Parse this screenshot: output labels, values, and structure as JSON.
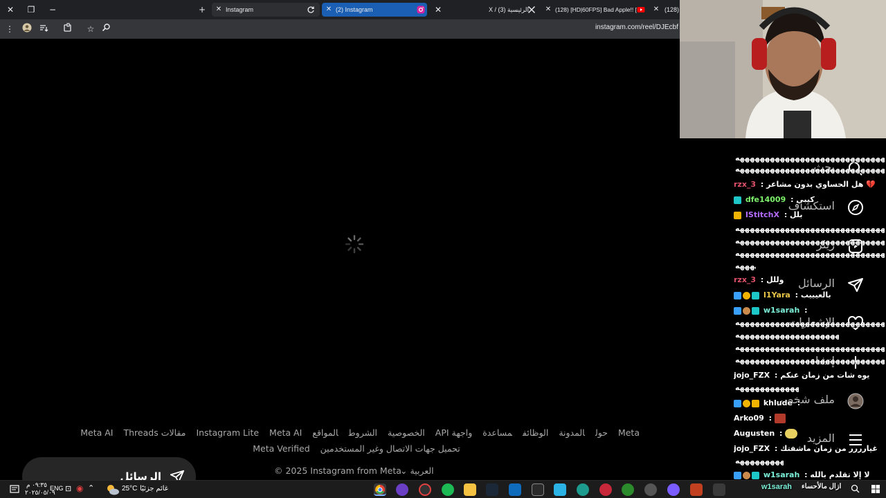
{
  "browser": {
    "window_controls": {
      "close": "✕",
      "restore": "❐",
      "minimize": "−",
      "new_tab": "+"
    },
    "tabs": [
      {
        "title": "Instagram",
        "close": "✕"
      },
      {
        "title": "(2) Instagram",
        "close": "✕",
        "active": true
      },
      {
        "title": "X / (3) الرئيسية",
        "close": "✕"
      },
      {
        "title": "(128) [HD|60FPS] Bad Apple!! [",
        "close": "✕"
      },
      {
        "title": "(128)",
        "close": "✕"
      }
    ],
    "url": "instagram.com/reel/DJEcbf"
  },
  "page": {
    "footer_row1": [
      "Meta",
      "حول",
      "المدونة",
      "الوظائف",
      "مساعدة",
      "واجهة API",
      "الخصوصية",
      "الشروط",
      "المواقع",
      "Instagram Lite",
      "Meta AI",
      "مقالات Meta AI",
      "Threads"
    ],
    "footer_row2": [
      "تحميل جهات الاتصال وغير المستخدمين",
      "Meta Verified"
    ],
    "language": "العربية",
    "copyright": "© 2025 Instagram from Meta",
    "messages_button": "الرسائل"
  },
  "sidebar_nav": [
    {
      "label": "بحث",
      "icon": "search-icon"
    },
    {
      "label": "استكشاف",
      "icon": "explore-icon"
    },
    {
      "label": "ريلز",
      "icon": "reels-icon"
    },
    {
      "label": "الرسائل",
      "icon": "messages-icon"
    },
    {
      "label": "الإشعارات",
      "icon": "heart-icon"
    },
    {
      "label": "إنشاء",
      "icon": "plus-icon"
    },
    {
      "label": "ملف شخصي",
      "icon": "avatar-icon"
    },
    {
      "label": "المزيد",
      "icon": "menu-icon"
    }
  ],
  "chat": {
    "spam_block": "ههههههههههههههههههههههههههههههههههههههههه",
    "messages": [
      {
        "user": "rzx_3",
        "text": "هل الحساوي بدون مشاعر",
        "color": "#e0516a",
        "emoji": "💔"
      },
      {
        "user": "dfe14009",
        "text": "كيبي",
        "color": "#7cf06a"
      },
      {
        "user": "IStitchX",
        "text": "بلل",
        "color": "#b46cff"
      },
      {
        "user": "rzx_3",
        "text": "وللل",
        "color": "#e0516a"
      },
      {
        "user": "I1Yara",
        "text": "بالعيييب",
        "color": "#e8c547"
      },
      {
        "user": "w1sarah",
        "text": "",
        "color": "#7cf0d8"
      },
      {
        "user": "jojo_FZX",
        "text": "يوه شات من زمان عنكم",
        "color": "#ffffff"
      },
      {
        "user": "khlude",
        "text": "",
        "color": "#ffffff"
      },
      {
        "user": "Arko09",
        "text": "",
        "color": "#ffffff"
      },
      {
        "user": "Augusten",
        "text": "",
        "color": "#ffffff"
      },
      {
        "user": "jojo_FZX",
        "text": "غيارررر من زمان ماشفتك",
        "color": "#ffffff"
      },
      {
        "user": "w1sarah",
        "text": "لا إلا تقلدم بالله",
        "color": "#7cf0d8"
      },
      {
        "user": "w1sarah",
        "text": "ازال مالأحساء",
        "color": "#7cf0d8"
      }
    ]
  },
  "taskbar": {
    "time": "٠٩:٣٥ م",
    "date": "٢٠٢٥/٠٥/٠٩",
    "lang": "ENG",
    "weather_temp": "25°C",
    "weather_text": "غائم جزئيًا"
  }
}
